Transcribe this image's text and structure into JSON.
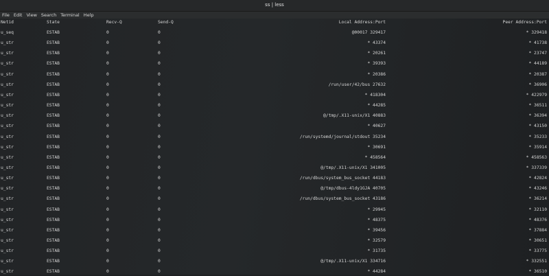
{
  "window": {
    "title": "ss | less"
  },
  "menu": [
    "File",
    "Edit",
    "View",
    "Search",
    "Terminal",
    "Help"
  ],
  "headers": [
    "Netid",
    "State",
    "Recv-Q",
    "Send-Q",
    "Local Address:Port",
    "Peer Address:Port"
  ],
  "rows": [
    [
      "u_seq",
      "ESTAB",
      "0",
      "0",
      "@00017 329417",
      "* 329418"
    ],
    [
      "u_str",
      "ESTAB",
      "0",
      "0",
      "* 43374",
      "* 41738"
    ],
    [
      "u_str",
      "ESTAB",
      "0",
      "0",
      "* 20261",
      "* 23747"
    ],
    [
      "u_str",
      "ESTAB",
      "0",
      "0",
      "* 39393",
      "* 44189"
    ],
    [
      "u_str",
      "ESTAB",
      "0",
      "0",
      "* 20386",
      "* 20387"
    ],
    [
      "u_str",
      "ESTAB",
      "0",
      "0",
      "/run/user/42/bus 27632",
      "* 36906"
    ],
    [
      "u_str",
      "ESTAB",
      "0",
      "0",
      "* 418304",
      "* 422979"
    ],
    [
      "u_str",
      "ESTAB",
      "0",
      "0",
      "* 44285",
      "* 36511"
    ],
    [
      "u_str",
      "ESTAB",
      "0",
      "0",
      "@/tmp/.X11-unix/X1 40883",
      "* 36394"
    ],
    [
      "u_str",
      "ESTAB",
      "0",
      "0",
      "* 40627",
      "* 43150"
    ],
    [
      "u_str",
      "ESTAB",
      "0",
      "0",
      "/run/systemd/journal/stdout 35234",
      "* 35233"
    ],
    [
      "u_str",
      "ESTAB",
      "0",
      "0",
      "* 30691",
      "* 35914"
    ],
    [
      "u_str",
      "ESTAB",
      "0",
      "0",
      "* 458564",
      "* 458563"
    ],
    [
      "u_str",
      "ESTAB",
      "0",
      "0",
      "@/tmp/.X11-unix/X1 341005",
      "* 337339"
    ],
    [
      "u_str",
      "ESTAB",
      "0",
      "0",
      "/run/dbus/system_bus_socket 44183",
      "* 42824"
    ],
    [
      "u_str",
      "ESTAB",
      "0",
      "0",
      "@/tmp/dbus-4ldy1GJA 40705",
      "* 43246"
    ],
    [
      "u_str",
      "ESTAB",
      "0",
      "0",
      "/run/dbus/system_bus_socket 43186",
      "* 36214"
    ],
    [
      "u_str",
      "ESTAB",
      "0",
      "0",
      "* 29945",
      "* 32110"
    ],
    [
      "u_str",
      "ESTAB",
      "0",
      "0",
      "* 48375",
      "* 48376"
    ],
    [
      "u_str",
      "ESTAB",
      "0",
      "0",
      "* 39456",
      "* 37884"
    ],
    [
      "u_str",
      "ESTAB",
      "0",
      "0",
      "* 32579",
      "* 30651"
    ],
    [
      "u_str",
      "ESTAB",
      "0",
      "0",
      "* 31735",
      "* 33775"
    ],
    [
      "u_str",
      "ESTAB",
      "0",
      "0",
      "@/tmp/.X11-unix/X1 334716",
      "* 332551"
    ],
    [
      "u_str",
      "ESTAB",
      "0",
      "0",
      "* 44284",
      "* 36510"
    ]
  ]
}
